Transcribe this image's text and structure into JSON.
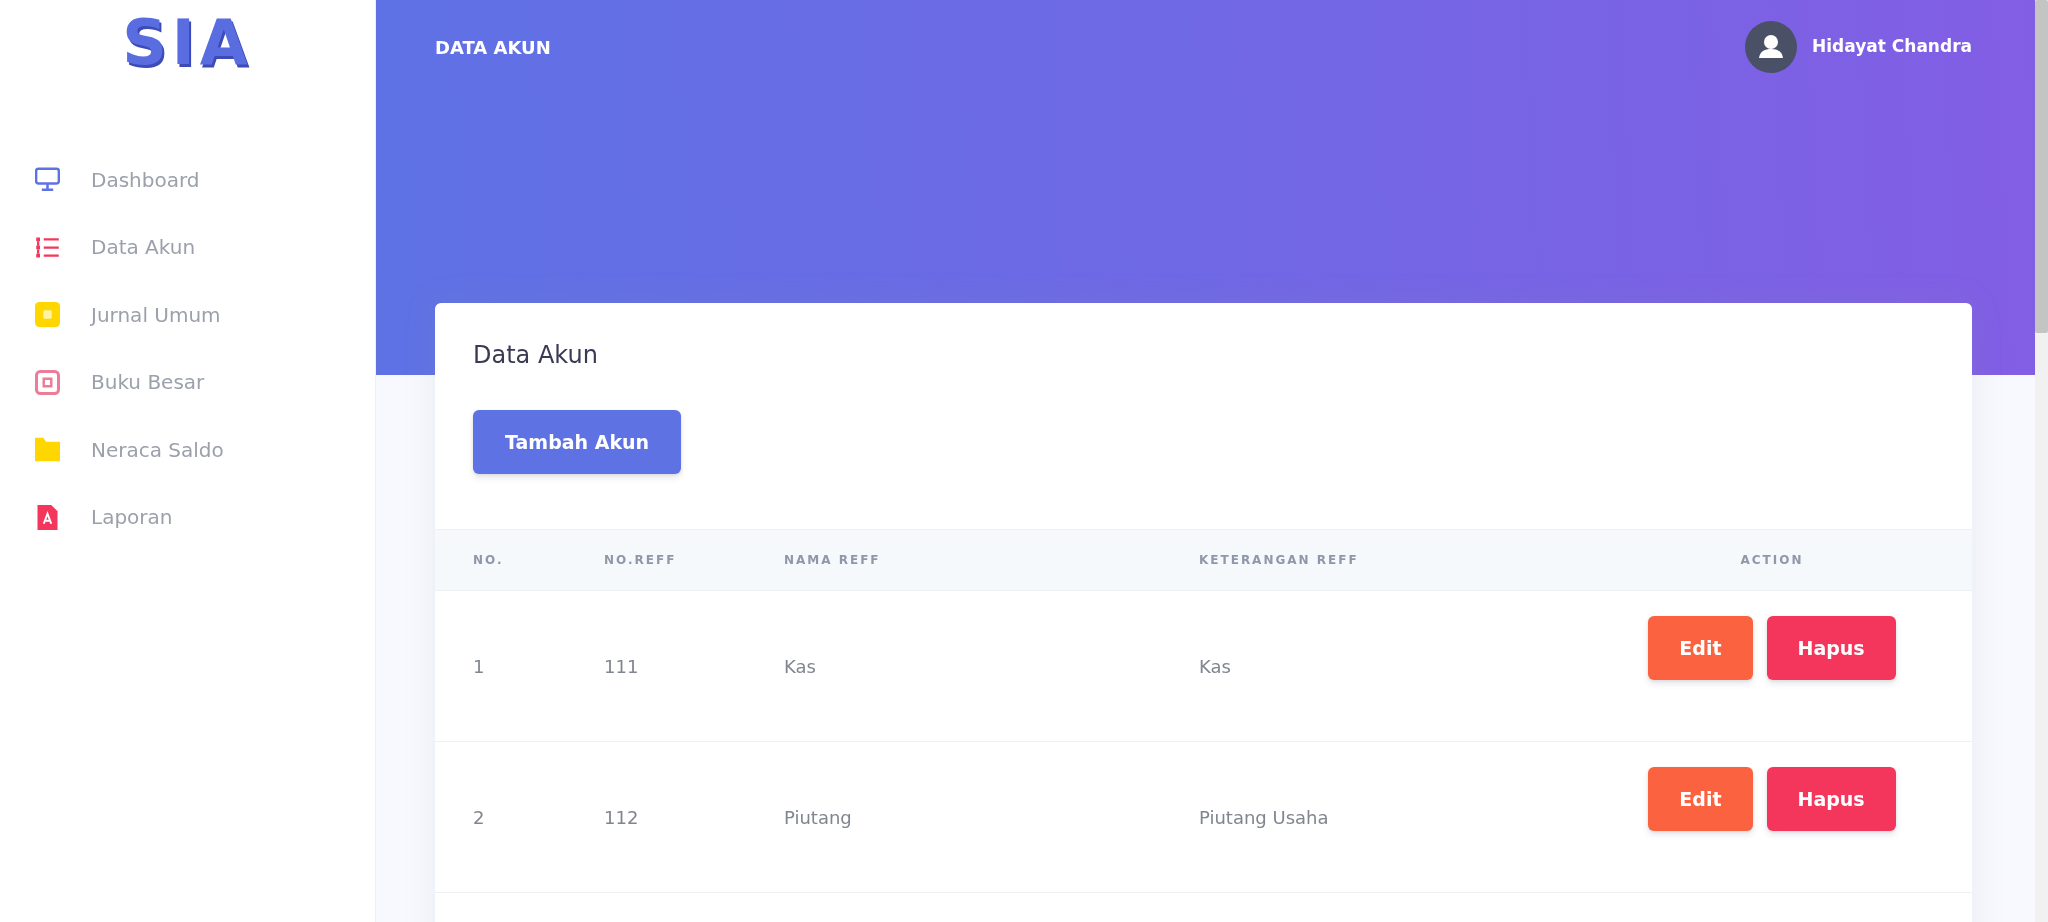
{
  "logo": {
    "text": "SIA"
  },
  "sidebar": {
    "items": [
      {
        "label": "Dashboard",
        "color": "#5e72e4"
      },
      {
        "label": "Data Akun",
        "color": "#f5365c"
      },
      {
        "label": "Jurnal Umum",
        "color": "#ffd600"
      },
      {
        "label": "Buku Besar",
        "color": "#ec7c98"
      },
      {
        "label": "Neraca Saldo",
        "color": "#ffd600"
      },
      {
        "label": "Laporan",
        "color": "#f5365c"
      }
    ]
  },
  "header": {
    "title": "DATA AKUN",
    "user": {
      "name": "Hidayat Chandra"
    }
  },
  "card": {
    "title": "Data Akun",
    "add_button": {
      "label": "Tambah Akun"
    },
    "table": {
      "columns": [
        "NO.",
        "NO.REFF",
        "NAMA REFF",
        "KETERANGAN REFF",
        "ACTION"
      ],
      "rows": [
        {
          "cells": [
            "1",
            "111",
            "Kas",
            "Kas"
          ],
          "actions": [
            {
              "label": "Edit",
              "kind": "edit"
            },
            {
              "label": "Hapus",
              "kind": "delete"
            }
          ]
        },
        {
          "cells": [
            "2",
            "112",
            "Piutang",
            "Piutang Usaha"
          ],
          "actions": [
            {
              "label": "Edit",
              "kind": "edit"
            },
            {
              "label": "Hapus",
              "kind": "delete"
            }
          ]
        }
      ]
    }
  }
}
